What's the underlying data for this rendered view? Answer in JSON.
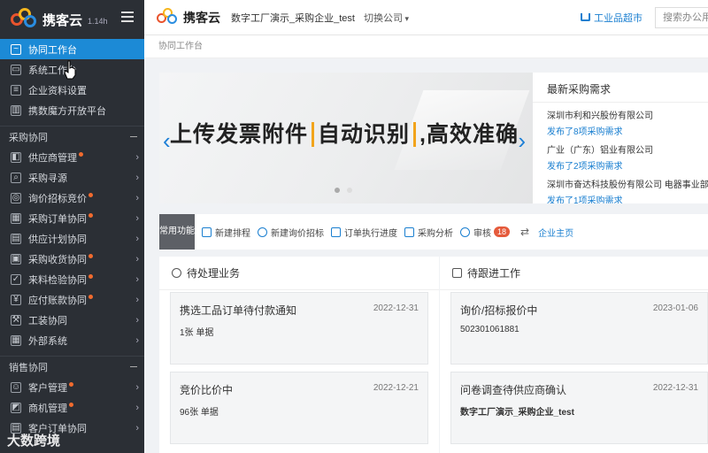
{
  "sidebar": {
    "brand": "携客云",
    "version": "1.14h",
    "top_items": [
      {
        "label": "协同工作台",
        "active": true
      },
      {
        "label": "系统工作台"
      },
      {
        "label": "企业资料设置"
      },
      {
        "label": "携数魔方开放平台"
      }
    ],
    "section_purchase": "采购协同",
    "purchase_items": [
      {
        "label": "供应商管理",
        "dot": true
      },
      {
        "label": "采购寻源",
        "dot": false
      },
      {
        "label": "询价招标竞价",
        "dot": true
      },
      {
        "label": "采购订单协同",
        "dot": true
      },
      {
        "label": "供应计划协同",
        "dot": false
      },
      {
        "label": "采购收货协同",
        "dot": true
      },
      {
        "label": "来料检验协同",
        "dot": true
      },
      {
        "label": "应付账款协同",
        "dot": true
      },
      {
        "label": "工装协同",
        "dot": false
      },
      {
        "label": "外部系统",
        "dot": false
      }
    ],
    "section_sales": "销售协同",
    "sales_items": [
      {
        "label": "客户管理",
        "dot": true
      },
      {
        "label": "商机管理",
        "dot": true
      },
      {
        "label": "客户订单协同",
        "dot": false
      }
    ]
  },
  "topbar": {
    "brand": "携客云",
    "company": "数字工厂演示_采购企业_test",
    "switch_label": "切换公司",
    "market_label": "工业品超市",
    "search_placeholder": "搜索办公用品"
  },
  "breadcrumb": "协同工作台",
  "banner": {
    "text_prefix": "上传发票附件",
    "text_highlight": "自动识别",
    "text_suffix": ",高效准确"
  },
  "procurement": {
    "title": "最新采购需求",
    "items": [
      {
        "company": "深圳市利和兴股份有限公司",
        "link": "发布了8项采购需求"
      },
      {
        "company": "广业（广东）铝业有限公司",
        "link": "发布了2项采购需求"
      },
      {
        "company": "深圳市奋达科技股份有限公司 电器事业部",
        "link": "发布了1项采购需求"
      }
    ]
  },
  "quick": {
    "tag": "常用功能",
    "items": [
      {
        "label": "新建排程"
      },
      {
        "label": "新建询价招标"
      },
      {
        "label": "订单执行进度"
      },
      {
        "label": "采购分析"
      },
      {
        "label": "审核",
        "badge": "18"
      }
    ],
    "home_label": "企业主页"
  },
  "pending": {
    "title": "待处理业务",
    "cards": [
      {
        "title": "携选工品订单待付款通知",
        "date": "2022-12-31",
        "sub": "1张 单据"
      },
      {
        "title": "竞价比价中",
        "date": "2022-12-21",
        "sub": "96张 单据"
      }
    ]
  },
  "followup": {
    "title": "待跟进工作",
    "cards": [
      {
        "title": "询价/招标报价中",
        "date": "2023-01-06",
        "sub": "502301061881"
      },
      {
        "title": "问卷调查待供应商确认",
        "date": "2022-12-31",
        "sub": "数字工厂演示_采购企业_test"
      }
    ]
  },
  "watermark": "大数跨境"
}
